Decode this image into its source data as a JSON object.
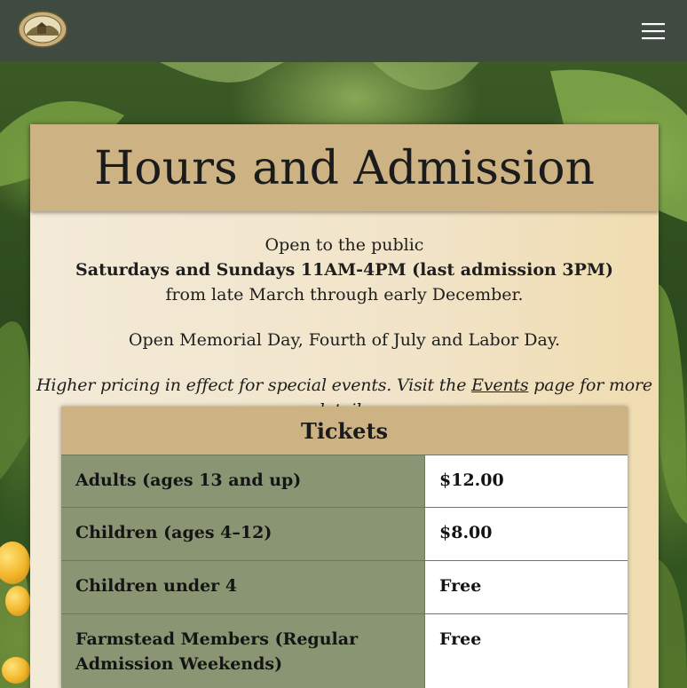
{
  "header": {
    "logo_icon": "farmstead-seal-logo",
    "menu_icon": "hamburger-menu-icon"
  },
  "page": {
    "title": "Hours and Admission",
    "intro_line1": "Open to the public",
    "intro_line2": "Saturdays and Sundays 11AM-4PM (last admission 3PM)",
    "intro_line3": "from late March through early December.",
    "holidays": "Open Memorial Day, Fourth of July and Labor Day.",
    "note_before": "Higher pricing in effect for special events. Visit the ",
    "note_link": "Events",
    "note_after": " page for more details."
  },
  "tickets": {
    "title": "Tickets",
    "rows": [
      {
        "label": "Adults (ages 13 and up)",
        "price": "$12.00"
      },
      {
        "label": "Children (ages 4–12)",
        "price": "$8.00"
      },
      {
        "label": "Children under 4",
        "price": "Free"
      },
      {
        "label": "Farmstead Members (Regular Admission Weekends)",
        "price": "Free"
      }
    ]
  },
  "colors": {
    "topbar": "#3f4a40",
    "card_header": "#cdb383",
    "label_cell": "#8a9673",
    "price_cell": "#ffffff"
  }
}
